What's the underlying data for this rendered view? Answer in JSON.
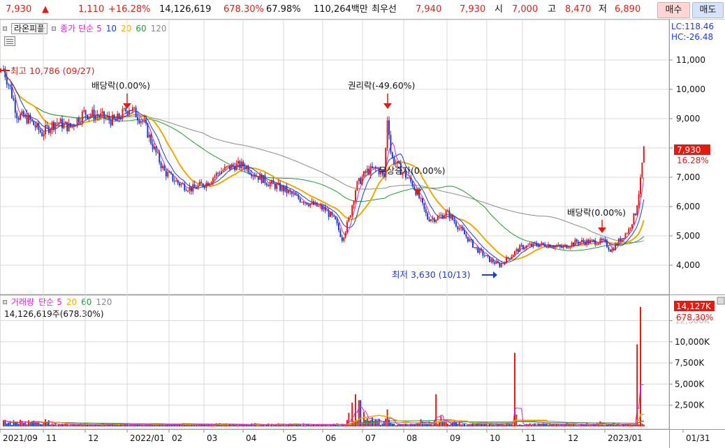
{
  "quote": {
    "price": "7,930",
    "up_arrow": "▲",
    "change": "1,110",
    "change_pct": "+16.28%",
    "volume": "14,126,619",
    "volume_ratio": "678.30%",
    "turnover": "67.98%",
    "trade_value": "110,264백만",
    "best_ask_label": "최우선",
    "best_ask": "7,940",
    "best_bid": "7,930",
    "open_label": "시",
    "open": "7,000",
    "high_label": "고",
    "high": "8,470",
    "low_label": "저",
    "low": "6,890",
    "buy_button": "매수",
    "sell_button": "매도"
  },
  "price_panel": {
    "stock_name": "라온피플",
    "ma_label": "종가 단순",
    "ma_periods": [
      "5",
      "10",
      "20",
      "60",
      "120"
    ],
    "lc": "LC:118.46",
    "hc": "HC:-26.48",
    "current_tag": "7,930",
    "current_pct": "16.28%",
    "y_ticks": [
      "11,000",
      "10,000",
      "9,000",
      "8,000",
      "7,000",
      "6,000",
      "5,000",
      "4,000"
    ],
    "annotations": {
      "high": "최고 10,786 (09/27)",
      "div1": "배당락(0.00%)",
      "rights": "권리락(-49.60%)",
      "bonus": "무상증자(0.00%)",
      "div2": "배당락(0.00%)",
      "low": "최저 3,630 (10/13)"
    }
  },
  "volume_panel": {
    "label": "거래량",
    "ma_label": "단순",
    "ma_periods": [
      "5",
      "20",
      "60",
      "120"
    ],
    "value_text": "14,126,619주(678.30%)",
    "current_tag": "14,127K",
    "current_pct": "678.30%",
    "y_ticks": [
      "12,500K",
      "10,000K",
      "7,500K",
      "5,000K",
      "2,500K"
    ]
  },
  "x_axis": {
    "labels": [
      "2021/09",
      "11",
      "12",
      "2022/01",
      "02",
      "03",
      "04",
      "05",
      "06",
      "07",
      "08",
      "09",
      "10",
      "11",
      "12",
      "2023/01",
      "01/31"
    ]
  },
  "colors": {
    "up": "#e8190f",
    "down": "#1a3cd8",
    "ma5": "#d81fd8",
    "ma10": "#1a3cd8",
    "ma20": "#f0a800",
    "ma60": "#1c9e2a",
    "ma120": "#8a8a8a"
  },
  "chart_data": {
    "type": "line",
    "title": "라온피플",
    "x": [
      "2021/09",
      "11",
      "12",
      "2022/01",
      "02",
      "03",
      "04",
      "05",
      "06",
      "07",
      "08",
      "09",
      "10",
      "11",
      "12",
      "2023/01"
    ],
    "series": [
      {
        "name": "종가",
        "values": [
          10700,
          8900,
          9100,
          9300,
          7200,
          6500,
          7300,
          6500,
          5600,
          7000,
          6000,
          5500,
          4000,
          4600,
          4700,
          7930
        ]
      }
    ],
    "ylim": [
      3500,
      11600
    ],
    "volume": [
      400,
      250,
      200,
      200,
      150,
      150,
      150,
      150,
      1600,
      1800,
      800,
      1200,
      600,
      1000,
      400,
      14127
    ]
  }
}
